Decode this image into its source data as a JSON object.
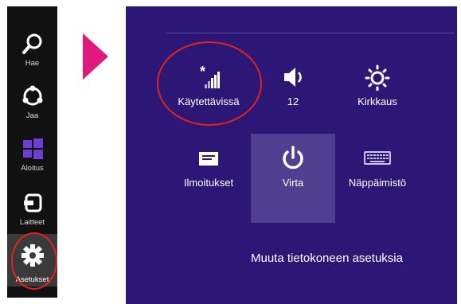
{
  "charms": [
    {
      "label": "Hae",
      "icon": "search-icon"
    },
    {
      "label": "Jaa",
      "icon": "share-icon"
    },
    {
      "label": "Aloitus",
      "icon": "windows-logo-icon"
    },
    {
      "label": "Laitteet",
      "icon": "devices-icon"
    },
    {
      "label": "Asetukset",
      "icon": "gear-icon",
      "selected": true
    }
  ],
  "quick_settings": [
    {
      "label": "Käytettävissä",
      "icon": "network-signal-icon"
    },
    {
      "label": "12",
      "icon": "volume-icon"
    },
    {
      "label": "Kirkkaus",
      "icon": "brightness-icon"
    },
    {
      "label": "Ilmoitukset",
      "icon": "notifications-icon"
    },
    {
      "label": "Virta",
      "icon": "power-icon",
      "highlighted": true
    },
    {
      "label": "Näppäimistö",
      "icon": "keyboard-icon"
    }
  ],
  "footer_link": "Muuta tietokoneen asetuksia",
  "colors": {
    "panel_background": "#2c1676",
    "charms_background": "#111111",
    "pointer_accent": "#e0197d",
    "annotation_ring": "#e2231a"
  }
}
